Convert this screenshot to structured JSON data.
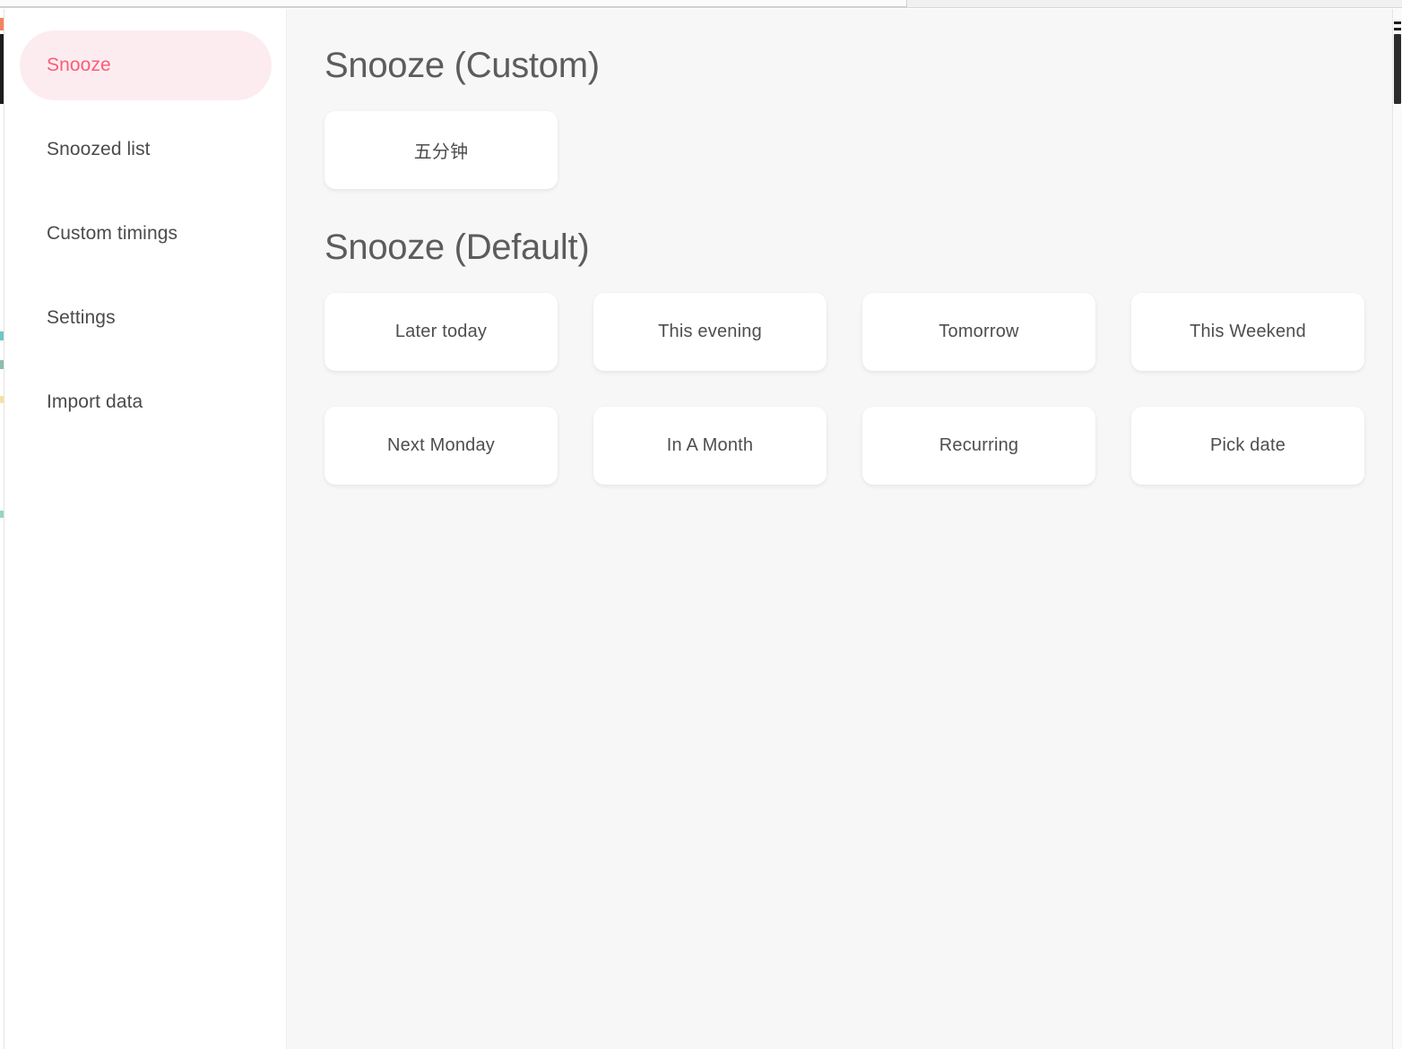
{
  "window": {
    "chrome_visible": true
  },
  "sidebar": {
    "items": [
      {
        "label": "Snooze",
        "active": true
      },
      {
        "label": "Snoozed list",
        "active": false
      },
      {
        "label": "Custom timings",
        "active": false
      },
      {
        "label": "Settings",
        "active": false
      },
      {
        "label": "Import data",
        "active": false
      }
    ]
  },
  "main": {
    "custom_section": {
      "title": "Snooze (Custom)",
      "buttons": [
        {
          "label": "五分钟"
        }
      ]
    },
    "default_section": {
      "title": "Snooze (Default)",
      "buttons": [
        {
          "label": "Later today"
        },
        {
          "label": "This evening"
        },
        {
          "label": "Tomorrow"
        },
        {
          "label": "This Weekend"
        },
        {
          "label": "Next Monday"
        },
        {
          "label": "In A Month"
        },
        {
          "label": "Recurring"
        },
        {
          "label": "Pick date"
        }
      ]
    }
  },
  "colors": {
    "accent_pink_text": "#fa5c77",
    "accent_pink_bg": "#fdecef",
    "content_bg": "#f7f7f7",
    "card_bg": "#ffffff",
    "sidebar_bg": "#ffffff",
    "heading_text": "#5c5c5e",
    "body_text": "#4b4b4d"
  }
}
